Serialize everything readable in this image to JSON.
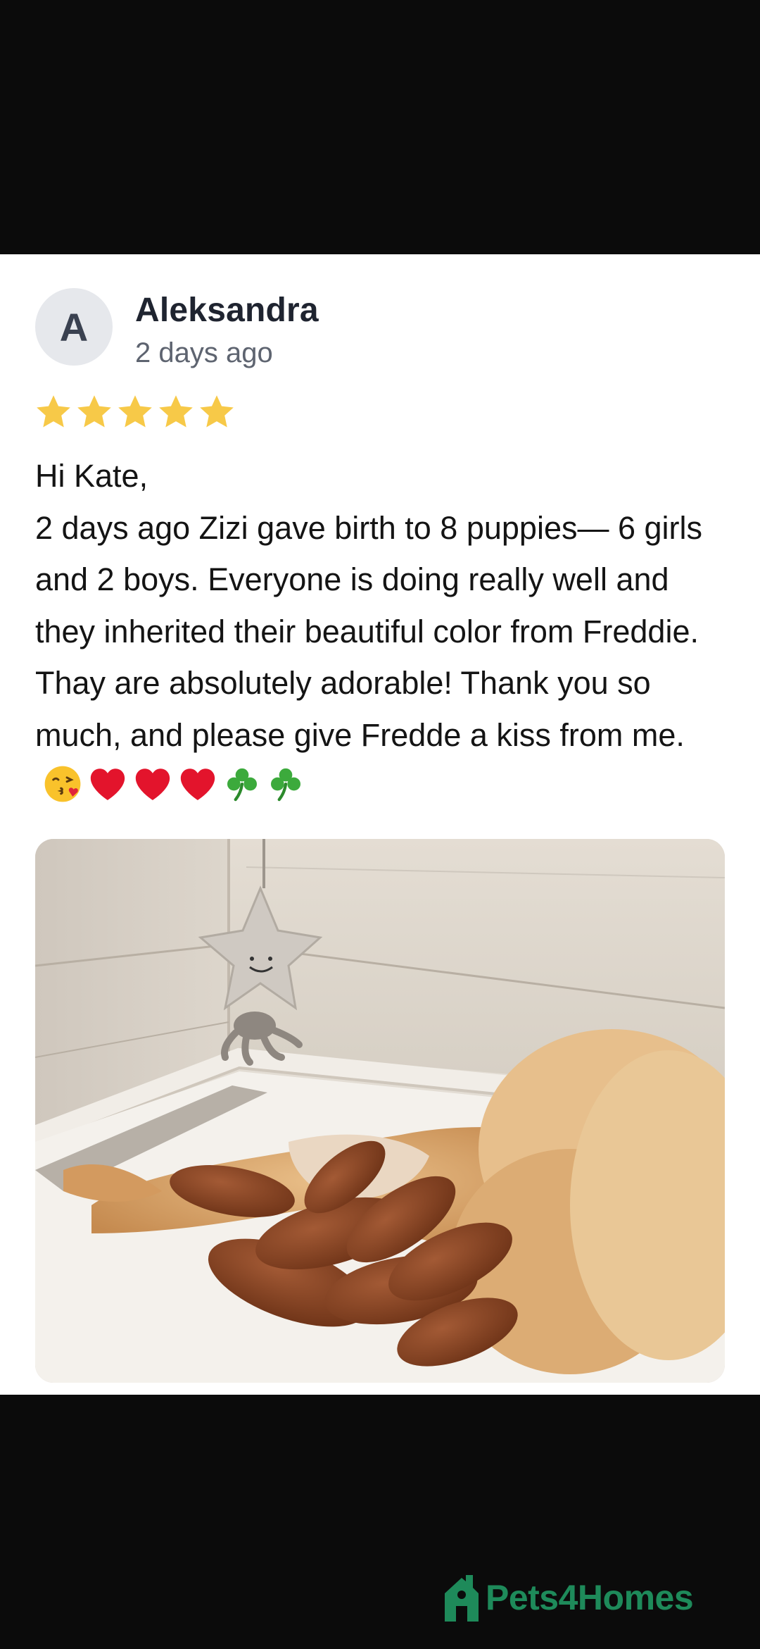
{
  "review": {
    "avatar_initial": "A",
    "reviewer_name": "Aleksandra",
    "time_ago": "2 days ago",
    "rating": 5,
    "rating_max": 5,
    "star_color": "#f7c948",
    "text": "Hi Kate,\n2 days ago Zizi gave birth to 8 puppies— 6 girls and 2 boys. Everyone is doing really well and they inherited their beautiful color from Freddie. Thay are absolutely adorable! Thank you so much, and please give Fredde a kiss from me.",
    "emojis": [
      "face-blowing-kiss-icon",
      "heart-icon",
      "heart-icon",
      "heart-icon",
      "shamrock-icon",
      "shamrock-icon"
    ]
  },
  "photo": {
    "subject": "dog-with-newborn-puppies"
  },
  "brand": {
    "name": "Pets4Homes",
    "color": "#1e8a5a"
  }
}
